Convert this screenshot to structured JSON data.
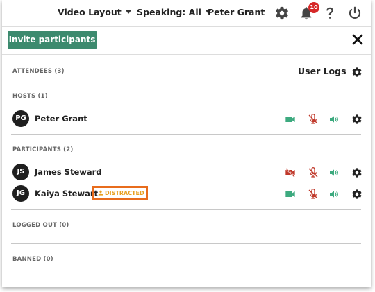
{
  "topbar": {
    "video_layout_label": "Video Layout",
    "speaking_label": "Speaking: All",
    "user_name": "Peter Grant",
    "notification_count": "10"
  },
  "actions": {
    "invite_label": "Invite participants",
    "user_logs_label": "User Logs"
  },
  "sections": {
    "attendees": "ATTENDEES (3)",
    "hosts": "HOSTS (1)",
    "participants": "PARTICIPANTS (2)",
    "logged_out": "LOGGED OUT (0)",
    "banned": "BANNED (0)"
  },
  "hosts": [
    {
      "initials": "PG",
      "name": "Peter Grant",
      "camera": "on",
      "mic": "muted",
      "speaker": "on"
    }
  ],
  "participants": [
    {
      "initials": "JS",
      "name": "James Steward",
      "camera": "off",
      "mic": "muted",
      "speaker": "on"
    },
    {
      "initials": "JG",
      "name": "Kaiya Stewart",
      "camera": "on",
      "mic": "muted",
      "speaker": "on",
      "status": "DISTRACTED"
    }
  ],
  "colors": {
    "accent_green": "#3c8a6e",
    "icon_green": "#3daa7f",
    "icon_red": "#c0392b",
    "badge_red": "#d62828",
    "distracted_border": "#e86c1c",
    "distracted_text": "#e8a020"
  }
}
